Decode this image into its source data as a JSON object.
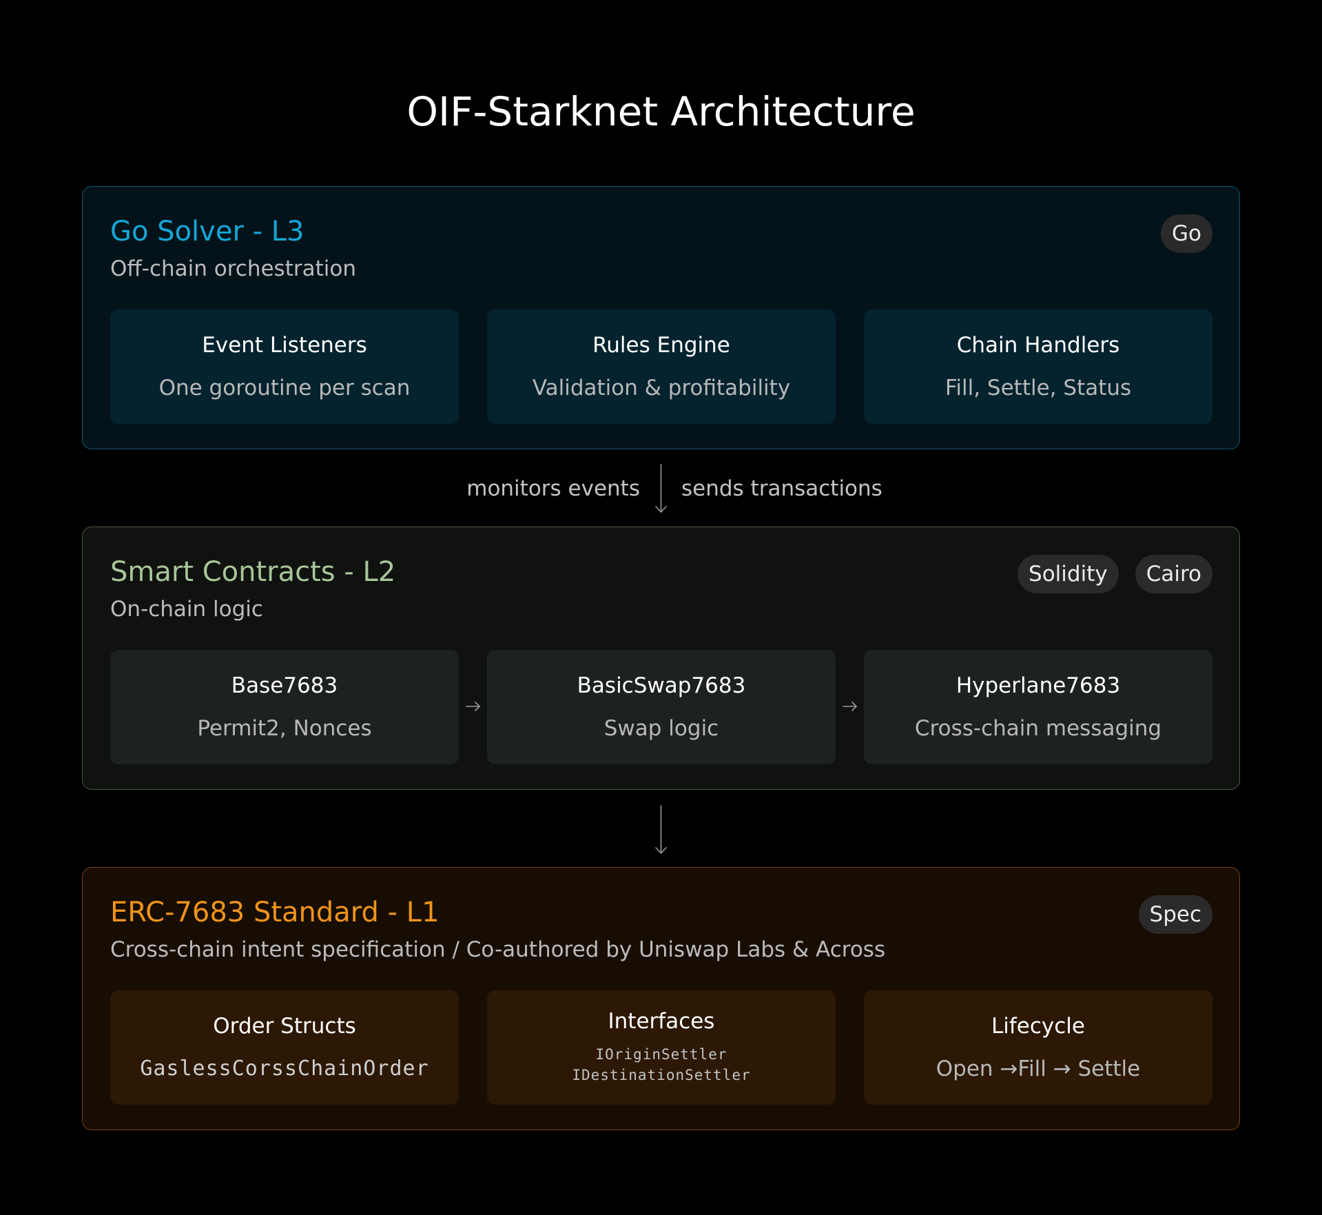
{
  "title": "OIF-Starknet Architecture",
  "colors": {
    "l3_accent": "#14a7d7",
    "l2_accent": "#a8c69a",
    "l1_accent": "#f09419"
  },
  "layers": [
    {
      "title": "Go Solver - L3",
      "subtitle": "Off-chain orchestration",
      "badges": [
        "Go"
      ],
      "cards": [
        {
          "title": "Event Listeners",
          "desc": "One goroutine per scan"
        },
        {
          "title": "Rules Engine",
          "desc": "Validation & profitability"
        },
        {
          "title": "Chain Handlers",
          "desc": "Fill, Settle, Status"
        }
      ]
    },
    {
      "title": "Smart Contracts - L2",
      "subtitle": "On-chain logic",
      "badges": [
        "Solidity",
        "Cairo"
      ],
      "cards": [
        {
          "title": "Base7683",
          "desc": "Permit2, Nonces"
        },
        {
          "title": "BasicSwap7683",
          "desc": "Swap logic"
        },
        {
          "title": "Hyperlane7683",
          "desc": "Cross-chain messaging"
        }
      ]
    },
    {
      "title": "ERC-7683 Standard - L1",
      "subtitle": "Cross-chain intent specification / Co-authored by Uniswap Labs & Across",
      "badges": [
        "Spec"
      ],
      "cards": [
        {
          "title": "Order Structs",
          "desc": "GaslessCorssChainOrder"
        },
        {
          "title": "Interfaces",
          "desc_lines": [
            "IOriginSettler",
            "IDestinationSettler"
          ]
        },
        {
          "title": "Lifecycle",
          "desc": "Open →Fill → Settle"
        }
      ]
    }
  ],
  "connectors": {
    "left_label": "monitors events",
    "right_label": "sends transactions"
  }
}
